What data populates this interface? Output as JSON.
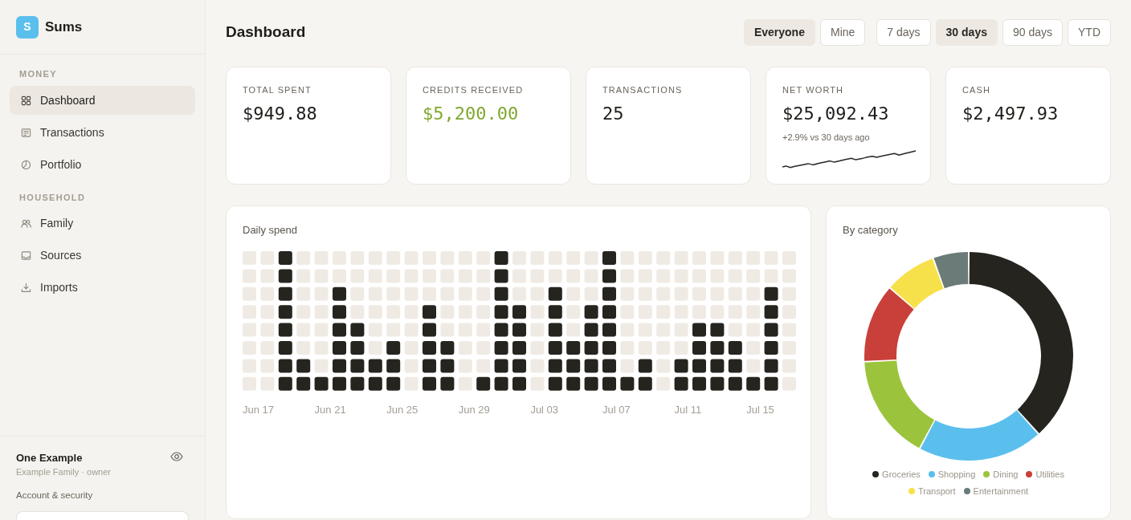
{
  "sidebar": {
    "logo_letter": "S",
    "app_name": "Sums",
    "sections": [
      {
        "heading": "MONEY",
        "items": [
          {
            "label": "Dashboard",
            "selected": true
          },
          {
            "label": "Transactions",
            "selected": false
          },
          {
            "label": "Portfolio",
            "selected": false
          }
        ]
      },
      {
        "heading": "HOUSEHOLD",
        "items": [
          {
            "label": "Family",
            "selected": false
          },
          {
            "label": "Sources",
            "selected": false
          },
          {
            "label": "Imports",
            "selected": false
          }
        ]
      }
    ],
    "user": {
      "name": "One Example",
      "subtitle": "Example Family · owner",
      "account_link": "Account & security"
    }
  },
  "header": {
    "title": "Dashboard",
    "scope_filters": [
      {
        "label": "Everyone",
        "selected": true
      },
      {
        "label": "Mine",
        "selected": false
      }
    ],
    "period_filters": [
      {
        "label": "7 days",
        "selected": false
      },
      {
        "label": "30 days",
        "selected": true
      },
      {
        "label": "90 days",
        "selected": false
      },
      {
        "label": "YTD",
        "selected": false
      }
    ]
  },
  "stats": [
    {
      "kind": "plain",
      "label": "TOTAL SPENT",
      "value": "$949.88"
    },
    {
      "kind": "credit",
      "label": "CREDITS RECEIVED",
      "value": "$5,200.00"
    },
    {
      "kind": "plain",
      "label": "TRANSACTIONS",
      "value": "25"
    },
    {
      "kind": "trend",
      "label": "NET WORTH",
      "value": "$25,092.43",
      "change": "+2.9% vs 30 days ago"
    },
    {
      "kind": "plain",
      "label": "CASH",
      "value": "$2,497.93"
    }
  ],
  "daily_spend": {
    "title": "Daily spend",
    "date_labels": [
      "Jun 17",
      "Jun 21",
      "Jun 25",
      "Jun 29",
      "Jul 03",
      "Jul 07",
      "Jul 11",
      "Jul 15"
    ]
  },
  "by_category": {
    "title": "By category",
    "legend": [
      {
        "label": "Groceries",
        "color": "#26241f"
      },
      {
        "label": "Shopping",
        "color": "#5bbfed"
      },
      {
        "label": "Dining",
        "color": "#9bc43c"
      },
      {
        "label": "Utilities",
        "color": "#c9403a"
      },
      {
        "label": "Transport",
        "color": "#f7e14a"
      },
      {
        "label": "Entertainment",
        "color": "#6b7b78"
      }
    ]
  }
}
